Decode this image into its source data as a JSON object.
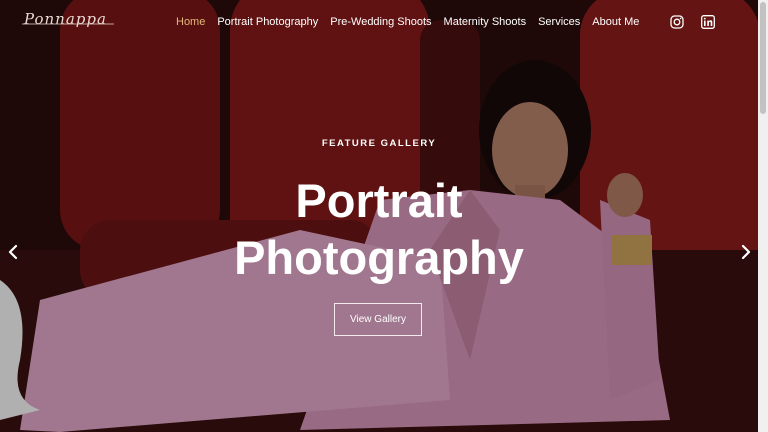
{
  "brand": {
    "logo_text": "Ponnappa"
  },
  "nav": {
    "items": [
      {
        "label": "Home",
        "active": true
      },
      {
        "label": "Portrait Photography",
        "active": false
      },
      {
        "label": "Pre-Wedding Shoots",
        "active": false
      },
      {
        "label": "Maternity Shoots",
        "active": false
      },
      {
        "label": "Services",
        "active": false
      },
      {
        "label": "About Me",
        "active": false
      }
    ],
    "social_icons": [
      "instagram-icon",
      "linkedin-icon"
    ]
  },
  "hero": {
    "eyebrow": "FEATURE GALLERY",
    "title_line1": "Portrait",
    "title_line2": "Photography",
    "cta_label": "View Gallery"
  },
  "carousel": {
    "prev_icon": "chevron-left-icon",
    "next_icon": "chevron-right-icon"
  },
  "colors": {
    "accent": "#e2b97d",
    "nav_text": "#ffffff",
    "seat_red": "#8b1a1a",
    "suit_pink": "#e0a6c6"
  }
}
